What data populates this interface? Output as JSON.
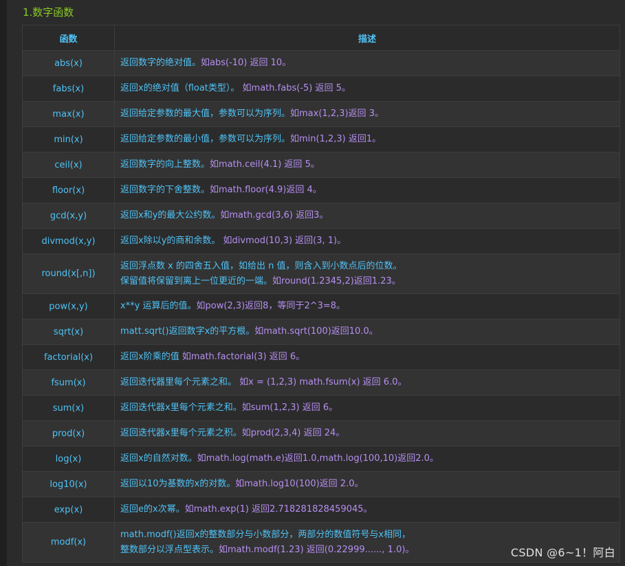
{
  "section_title": "1.数字函数",
  "table": {
    "headers": {
      "function": "函数",
      "description": "描述"
    },
    "rows": [
      {
        "name": "abs(x)",
        "lines": [
          {
            "text": "返回数字的绝对值。",
            "example": "如abs(-10) 返回 10。"
          }
        ]
      },
      {
        "name": "fabs(x)",
        "lines": [
          {
            "text": "返回x的绝对值（float类型）。 ",
            "example": "如math.fabs(-5) 返回 5。"
          }
        ]
      },
      {
        "name": "max(x)",
        "lines": [
          {
            "text": "返回给定参数的最大值，参数可以为序列。",
            "example": "如max(1,2,3)返回 3。"
          }
        ]
      },
      {
        "name": "min(x)",
        "lines": [
          {
            "text": "返回给定参数的最小值，参数可以为序列。",
            "example": "如min(1,2,3) 返回1。"
          }
        ]
      },
      {
        "name": "ceil(x)",
        "lines": [
          {
            "text": "返回数字的向上整数。",
            "example": "如math.ceil(4.1) 返回 5。"
          }
        ]
      },
      {
        "name": "floor(x)",
        "lines": [
          {
            "text": "返回数字的下舍整数。",
            "example": "如math.floor(4.9)返回 4。"
          }
        ]
      },
      {
        "name": "gcd(x,y)",
        "lines": [
          {
            "text": "返回x和y的最大公约数。",
            "example": "如math.gcd(3,6) 返回3。"
          }
        ]
      },
      {
        "name": "divmod(x,y)",
        "lines": [
          {
            "text": "返回x除以y的商和余数。 ",
            "example": "如divmod(10,3) 返回(3, 1)。"
          }
        ]
      },
      {
        "name": "round(x[,n])",
        "lines": [
          {
            "text": "返回浮点数 x 的四舍五入值，如给出 n 值，则含入到小数点后的位数。",
            "example": ""
          },
          {
            "text": "保留值将保留到离上一位更近的一端。",
            "example": "如round(1.2345,2)返回1.23。"
          }
        ]
      },
      {
        "name": "pow(x,y)",
        "lines": [
          {
            "text": "x**y 运算后的值。",
            "example": "如pow(2,3)返回8，等同于2^3=8。"
          }
        ]
      },
      {
        "name": "sqrt(x)",
        "lines": [
          {
            "text": "matt.sqrt()返回数字x的平方根。",
            "example": "如math.sqrt(100)返回10.0。"
          }
        ]
      },
      {
        "name": "factorial(x)",
        "lines": [
          {
            "text": "返回x阶乘的值 ",
            "example": "如math.factorial(3) 返回 6。"
          }
        ]
      },
      {
        "name": "fsum(x)",
        "lines": [
          {
            "text": "返回迭代器里每个元素之和。  ",
            "example": "如x = (1,2,3) math.fsum(x) 返回 6.0。"
          }
        ]
      },
      {
        "name": "sum(x)",
        "lines": [
          {
            "text": "返回迭代器x里每个元素之和。",
            "example": "如sum(1,2,3) 返回 6。"
          }
        ]
      },
      {
        "name": "prod(x)",
        "lines": [
          {
            "text": "返回迭代器x里每个元素之积。",
            "example": "如prod(2,3,4) 返回 24。"
          }
        ]
      },
      {
        "name": "log(x)",
        "lines": [
          {
            "text": "返回x的自然对数。",
            "example": "如math.log(math.e)返回1.0,math.log(100,10)返回2.0。"
          }
        ]
      },
      {
        "name": "log10(x)",
        "lines": [
          {
            "text": "返回以10为基数的x的对数。",
            "example": "如math.log10(100)返回 2.0。"
          }
        ]
      },
      {
        "name": "exp(x)",
        "lines": [
          {
            "text": "返回e的x次幂。",
            "example": "如math.exp(1) 返回2.718281828459045。"
          }
        ]
      },
      {
        "name": "modf(x)",
        "lines": [
          {
            "text": "math.modf()返回x的整数部分与小数部分，两部分的数值符号与x相同，",
            "example": ""
          },
          {
            "text": "整数部分以浮点型表示。",
            "example": "如math.modf(1.23) 返回(0.22999......, 1.0)。"
          }
        ]
      }
    ]
  },
  "watermark": "CSDN @6~1！阿白",
  "colors": {
    "background": "#2b2b2b",
    "title": "#8ac926",
    "text": "#4fc3f7",
    "example": "#b78ff2"
  }
}
